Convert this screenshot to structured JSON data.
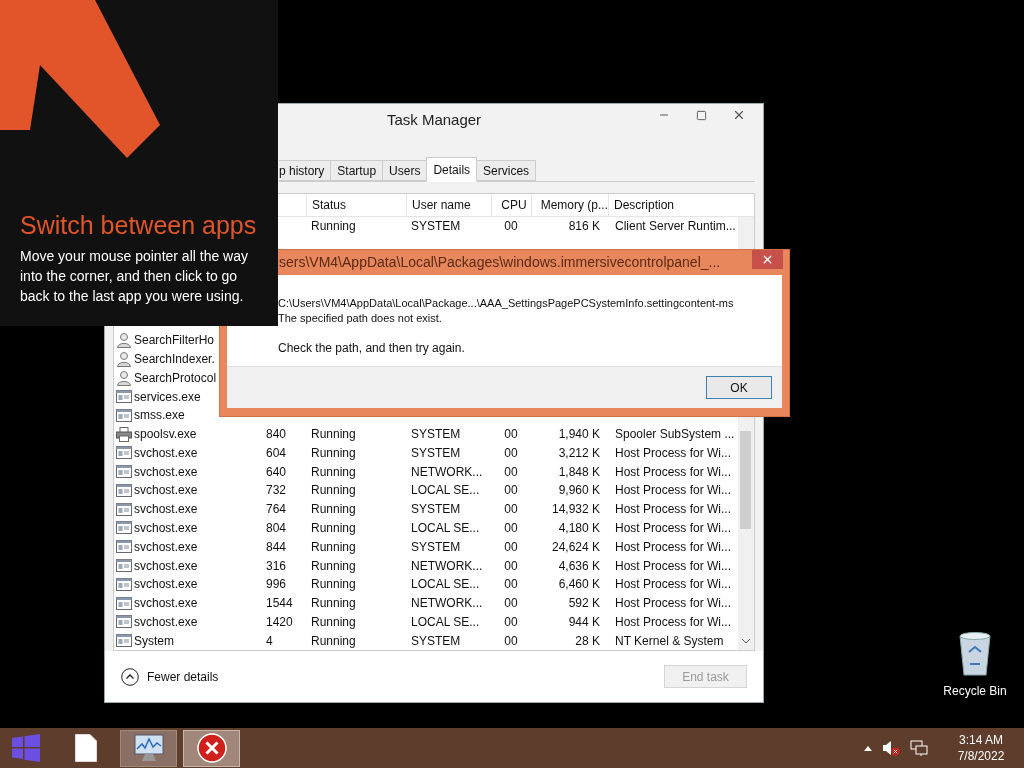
{
  "tip_overlay": {
    "title": "Switch between apps",
    "body": "Move your mouse pointer all the way into the corner, and then click to go back to the last app you were using."
  },
  "task_manager": {
    "title": "Task Manager",
    "tabs": [
      {
        "label": "p history",
        "selected": false
      },
      {
        "label": "Startup",
        "selected": false
      },
      {
        "label": "Users",
        "selected": false
      },
      {
        "label": "Details",
        "selected": true
      },
      {
        "label": "Services",
        "selected": false
      }
    ],
    "columns": [
      "Status",
      "User name",
      "CPU",
      "Memory (p...",
      "Description"
    ],
    "rows_top": [
      {
        "status": "Running",
        "user": "SYSTEM",
        "cpu": "00",
        "memory": "816 K",
        "description": "Client Server Runtim..."
      }
    ],
    "rows": [
      {
        "kind": "user",
        "name": "SearchFilterHo"
      },
      {
        "kind": "user",
        "name": "SearchIndexer."
      },
      {
        "kind": "user",
        "name": "SearchProtocol"
      },
      {
        "kind": "app",
        "name": "services.exe"
      },
      {
        "kind": "app",
        "name": "smss.exe"
      },
      {
        "kind": "printer",
        "name": "spoolsv.exe",
        "pid": "840",
        "status": "Running",
        "user": "SYSTEM",
        "cpu": "00",
        "memory": "1,940 K",
        "description": "Spooler SubSystem ..."
      },
      {
        "kind": "app",
        "name": "svchost.exe",
        "pid": "604",
        "status": "Running",
        "user": "SYSTEM",
        "cpu": "00",
        "memory": "3,212 K",
        "description": "Host Process for Wi..."
      },
      {
        "kind": "app",
        "name": "svchost.exe",
        "pid": "640",
        "status": "Running",
        "user": "NETWORK...",
        "cpu": "00",
        "memory": "1,848 K",
        "description": "Host Process for Wi..."
      },
      {
        "kind": "app",
        "name": "svchost.exe",
        "pid": "732",
        "status": "Running",
        "user": "LOCAL SE...",
        "cpu": "00",
        "memory": "9,960 K",
        "description": "Host Process for Wi..."
      },
      {
        "kind": "app",
        "name": "svchost.exe",
        "pid": "764",
        "status": "Running",
        "user": "SYSTEM",
        "cpu": "00",
        "memory": "14,932 K",
        "description": "Host Process for Wi..."
      },
      {
        "kind": "app",
        "name": "svchost.exe",
        "pid": "804",
        "status": "Running",
        "user": "LOCAL SE...",
        "cpu": "00",
        "memory": "4,180 K",
        "description": "Host Process for Wi..."
      },
      {
        "kind": "app",
        "name": "svchost.exe",
        "pid": "844",
        "status": "Running",
        "user": "SYSTEM",
        "cpu": "00",
        "memory": "24,624 K",
        "description": "Host Process for Wi..."
      },
      {
        "kind": "app",
        "name": "svchost.exe",
        "pid": "316",
        "status": "Running",
        "user": "NETWORK...",
        "cpu": "00",
        "memory": "4,636 K",
        "description": "Host Process for Wi..."
      },
      {
        "kind": "app",
        "name": "svchost.exe",
        "pid": "996",
        "status": "Running",
        "user": "LOCAL SE...",
        "cpu": "00",
        "memory": "6,460 K",
        "description": "Host Process for Wi..."
      },
      {
        "kind": "app",
        "name": "svchost.exe",
        "pid": "1544",
        "status": "Running",
        "user": "NETWORK...",
        "cpu": "00",
        "memory": "592 K",
        "description": "Host Process for Wi..."
      },
      {
        "kind": "app",
        "name": "svchost.exe",
        "pid": "1420",
        "status": "Running",
        "user": "LOCAL SE...",
        "cpu": "00",
        "memory": "944 K",
        "description": "Host Process for Wi..."
      },
      {
        "kind": "app",
        "name": "System",
        "pid": "4",
        "status": "Running",
        "user": "SYSTEM",
        "cpu": "00",
        "memory": "28 K",
        "description": "NT Kernel & System"
      }
    ],
    "footer": {
      "toggle": "Fewer details",
      "end_task": {
        "label": "End task",
        "disabled": true
      }
    }
  },
  "error_dialog": {
    "title": "sers\\VM4\\AppData\\Local\\Packages\\windows.immersivecontrolpanel_...",
    "lines": [
      "C:\\Users\\VM4\\AppData\\Local\\Package...\\AAA_SettingsPagePCSystemInfo.settingcontent-ms",
      "The specified path does not exist."
    ],
    "hint": "Check the path, and then try again.",
    "ok": "OK"
  },
  "desktop_icons": [
    {
      "label": "Recycle Bin"
    }
  ],
  "taskbar": {
    "apps": [
      {
        "kind": "file",
        "running": false,
        "selected": false
      },
      {
        "kind": "monitor",
        "running": true,
        "selected": false
      },
      {
        "kind": "error",
        "running": true,
        "selected": true
      }
    ],
    "time": "3:14 AM",
    "date": "7/8/2022"
  }
}
